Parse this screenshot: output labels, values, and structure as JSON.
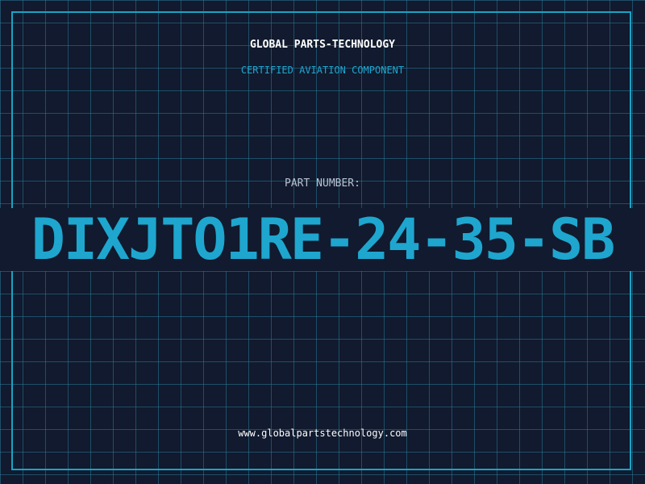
{
  "header": {
    "company_name": "GLOBAL PARTS-TECHNOLOGY",
    "tagline": "CERTIFIED AVIATION COMPONENT"
  },
  "part": {
    "label": "PART NUMBER:",
    "number": "DIXJTO1RE-24-35-SB"
  },
  "footer": {
    "website": "www.globalpartstechnology.com"
  },
  "colors": {
    "background": "#111a2e",
    "grid": "#287896",
    "accent": "#1ea6cf",
    "frame": "#1aa3c4",
    "text": "#ffffff"
  }
}
